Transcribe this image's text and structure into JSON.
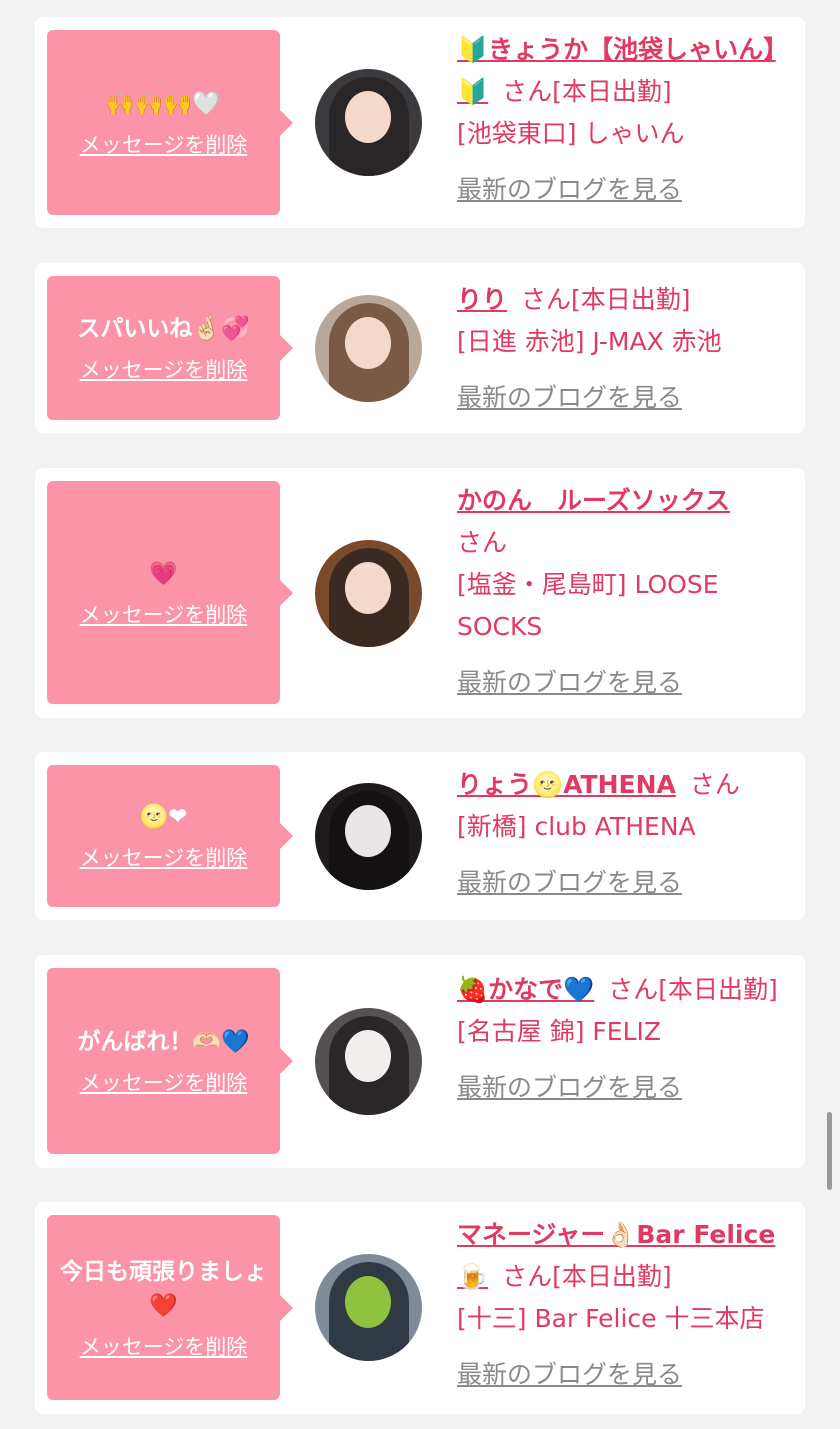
{
  "entries": [
    {
      "message": "🙌🙌🙌🤍",
      "delete_label": "メッセージを削除",
      "name": "🔰きょうか【池袋しゃいん】🔰",
      "suffix": "さん",
      "status": "[本日出勤]",
      "shop": "[池袋東口] しゃいん",
      "blog_link": "最新のブログを見る"
    },
    {
      "message": "スパいいね🤞🏻💞",
      "delete_label": "メッセージを削除",
      "name": "りり",
      "suffix": "さん",
      "status": "[本日出勤]",
      "shop": "[日進 赤池] J-MAX 赤池",
      "blog_link": "最新のブログを見る"
    },
    {
      "message": "💗",
      "delete_label": "メッセージを削除",
      "name": "かのん　ルーズソックス",
      "suffix": "さん",
      "status": "",
      "shop": "[塩釜・尾島町] LOOSE SOCKS",
      "blog_link": "最新のブログを見る"
    },
    {
      "message": "🌝❤",
      "delete_label": "メッセージを削除",
      "name": "りょう🌝ATHENA",
      "suffix": "さん",
      "status": "",
      "shop": "[新橋] club ATHENA",
      "blog_link": "最新のブログを見る"
    },
    {
      "message": "がんばれ！🫶🏻💙",
      "delete_label": "メッセージを削除",
      "name": "🍓かなで💙",
      "suffix": "さん",
      "status": "[本日出勤]",
      "shop": "[名古屋 錦] FELIZ",
      "blog_link": "最新のブログを見る"
    },
    {
      "message": "今日も頑張りましょ❤️",
      "delete_label": "メッセージを削除",
      "name": "マネージャー👌🏻Bar Felice🍺",
      "suffix": "さん",
      "status": "[本日出勤]",
      "shop": "[十三] Bar Felice 十三本店",
      "blog_link": "最新のブログを見る"
    }
  ],
  "colors": {
    "background": "#f2f2f2",
    "card": "#ffffff",
    "bubble": "#fb94a6",
    "accent": "#e03a63",
    "link_gray": "#8a8a8a"
  }
}
